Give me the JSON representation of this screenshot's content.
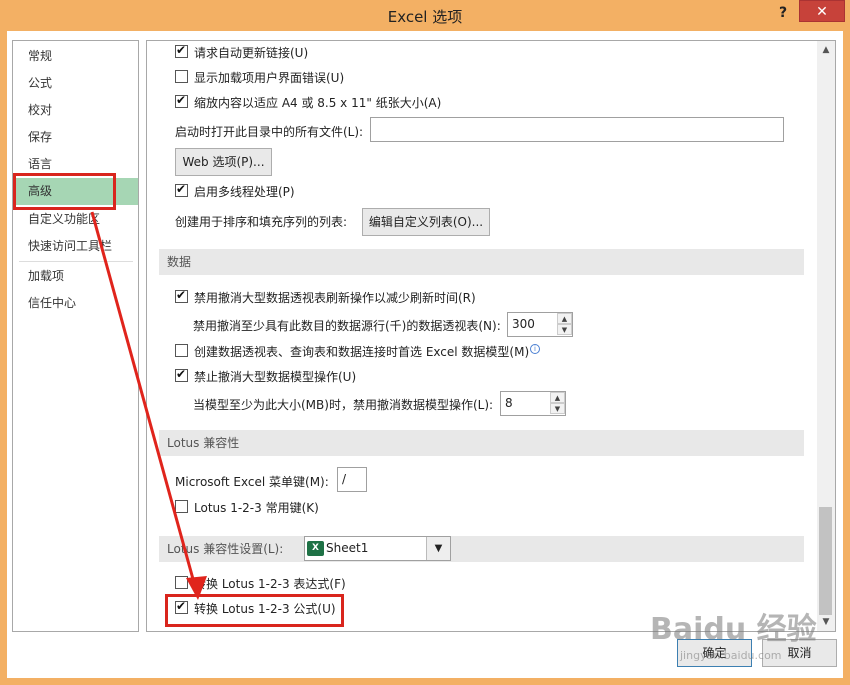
{
  "window": {
    "title": "Excel 选项",
    "help": "?",
    "close": "✕"
  },
  "sidebar": {
    "items": [
      "常规",
      "公式",
      "校对",
      "保存",
      "语言",
      "高级",
      "自定义功能区",
      "快速访问工具栏",
      "加载项",
      "信任中心"
    ],
    "active": "高级"
  },
  "general": {
    "request_update_links": "请求自动更新链接(U)",
    "show_addin_errors": "显示加载项用户界面错误(U)",
    "scale_content": "缩放内容以适应 A4 或 8.5 x 11\" 纸张大小(A)",
    "startup_open_label": "启动时打开此目录中的所有文件(L):",
    "startup_open_value": "",
    "web_options": "Web 选项(P)...",
    "multithread": "启用多线程处理(P)",
    "custom_list_label": "创建用于排序和填充序列的列表:",
    "edit_custom_list": "编辑自定义列表(O)..."
  },
  "data": {
    "header": "数据",
    "disable_undo_pivot": "禁用撤消大型数据透视表刷新操作以减少刷新时间(R)",
    "pivot_rows_label": "禁用撤消至少具有此数目的数据源行(千)的数据透视表(N):",
    "pivot_rows_value": "300",
    "prefer_data_model": "创建数据透视表、查询表和数据连接时首选 Excel 数据模型(M)",
    "disable_undo_model": "禁止撤消大型数据模型操作(U)",
    "model_size_label": "当模型至少为此大小(MB)时，禁用撤消数据模型操作(L):",
    "model_size_value": "8"
  },
  "lotus": {
    "header": "Lotus 兼容性",
    "menu_key_label": "Microsoft Excel 菜单键(M):",
    "menu_key_value": "/",
    "nav_keys": "Lotus 1-2-3 常用键(K)"
  },
  "lotus_settings": {
    "header_label": "Lotus 兼容性设置(L):",
    "sheet": "Sheet1",
    "transition_formula_eval": "转换 Lotus 1-2-3 表达式(F)",
    "transition_formula_entry": "转换 Lotus 1-2-3 公式(U)"
  },
  "footer": {
    "ok": "确定",
    "cancel": "取消"
  },
  "watermark": {
    "main": "Baidu 经验",
    "sub": "jingyan.baidu.com"
  },
  "icons": {
    "info": "i",
    "excel": "X"
  },
  "colors": {
    "titlebar": "#f3b064",
    "active_nav": "#a6d6b4",
    "highlight": "#d9251d"
  }
}
